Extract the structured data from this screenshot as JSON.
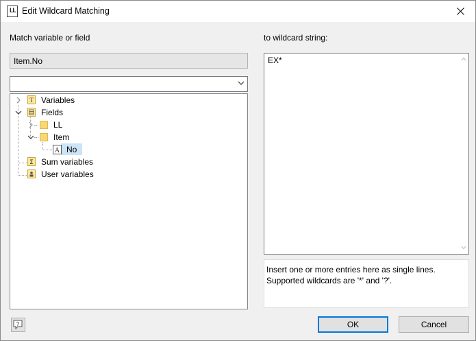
{
  "window": {
    "title": "Edit Wildcard Matching",
    "app_icon_text": "LL"
  },
  "left": {
    "label": "Match variable or field",
    "selected_field": "Item.No",
    "combo_value": ""
  },
  "tree": {
    "variables": "Variables",
    "fields": "Fields",
    "ll": "LL",
    "item": "Item",
    "no": "No",
    "sum_variables": "Sum variables",
    "user_variables": "User variables"
  },
  "right": {
    "label": "to wildcard string:",
    "value": "EX*",
    "hint_line1": "Insert one or more entries here as single lines.",
    "hint_line2": "Supported wildcards are '*' and '?'."
  },
  "buttons": {
    "ok": "OK",
    "cancel": "Cancel",
    "help": "?"
  },
  "colors": {
    "accent": "#0078d7",
    "selection": "#cce4f7",
    "folder": "#f8d775"
  }
}
